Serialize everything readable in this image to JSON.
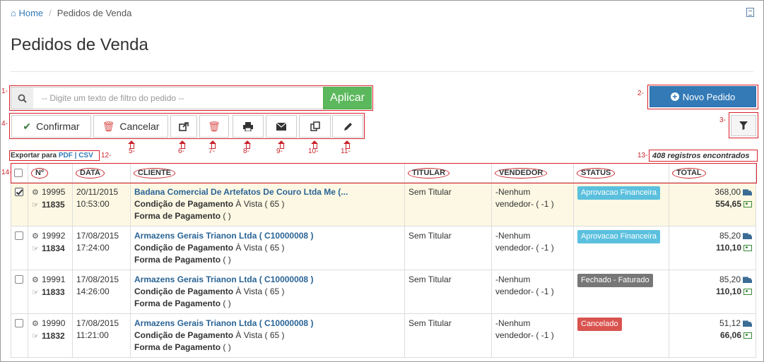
{
  "breadcrumb": {
    "home": "Home",
    "current": "Pedidos de Venda"
  },
  "page_title": "Pedidos de Venda",
  "search": {
    "placeholder": "-- Digite um texto de filtro do pedido --",
    "button": "Aplicar"
  },
  "new_order_button": "Novo Pedido",
  "toolbar": {
    "confirm": "Confirmar",
    "cancel": "Cancelar"
  },
  "annotations": {
    "n1": "1-",
    "n2": "2-",
    "n3": "3-",
    "n4": "4-",
    "n5": "5-",
    "n6": "6-",
    "n7": "7-",
    "n8": "8-",
    "n9": "9-",
    "n10": "10-",
    "n11": "11-",
    "n12": "12-",
    "n13": "13-",
    "n14": "14-"
  },
  "export": {
    "label": "Exportar para",
    "pdf": "PDF",
    "separator": "|",
    "csv": "CSV"
  },
  "records_found": "408 registros encontrados",
  "table": {
    "headers": {
      "num": "Nº",
      "date": "DATA",
      "client": "CLIENTE",
      "holder": "TITULAR",
      "seller": "VENDEDOR",
      "status": "STATUS",
      "total": "TOTAL"
    },
    "payment_condition_label": "Condição de Pagamento",
    "payment_form_label": "Forma de Pagamento",
    "rows": [
      {
        "id": "19995",
        "number": "11835",
        "date": "20/11/2015",
        "time": "10:53:00",
        "client": "Badana Comercial De Artefatos De Couro Ltda Me (...",
        "payment_condition": "À Vista ( 65 )",
        "payment_form": "( )",
        "holder": "Sem Titular",
        "seller1": "-Nenhum",
        "seller2": "vendedor- ( -1 )",
        "status": "Aprovacao Financeira",
        "status_color": "#5bc0de",
        "subtotal": "368,00",
        "total": "554,65",
        "checked": true
      },
      {
        "id": "19992",
        "number": "11834",
        "date": "17/08/2015",
        "time": "17:24:00",
        "client": "Armazens Gerais Trianon Ltda ( C10000008 )",
        "payment_condition": "À Vista ( 65 )",
        "payment_form": "( )",
        "holder": "Sem Titular",
        "seller1": "-Nenhum",
        "seller2": "vendedor- ( -1 )",
        "status": "Aprovacao Financeira",
        "status_color": "#5bc0de",
        "subtotal": "85,20",
        "total": "110,10",
        "checked": false
      },
      {
        "id": "19991",
        "number": "11833",
        "date": "17/08/2015",
        "time": "14:26:00",
        "client": "Armazens Gerais Trianon Ltda ( C10000008 )",
        "payment_condition": "À Vista ( 65 )",
        "payment_form": "( )",
        "holder": "Sem Titular",
        "seller1": "-Nenhum",
        "seller2": "vendedor- ( -1 )",
        "status": "Fechado - Faturado",
        "status_color": "#777777",
        "subtotal": "85,20",
        "total": "110,10",
        "checked": false
      },
      {
        "id": "19990",
        "number": "11832",
        "date": "17/08/2015",
        "time": "11:21:00",
        "client": "Armazens Gerais Trianon Ltda ( C10000008 )",
        "payment_condition": "À Vista ( 65 )",
        "payment_form": "( )",
        "holder": "Sem Titular",
        "seller1": "-Nenhum",
        "seller2": "vendedor- ( -1 )",
        "status": "Cancelado",
        "status_color": "#d9534f",
        "subtotal": "51,12",
        "total": "66,06",
        "checked": false
      }
    ]
  }
}
